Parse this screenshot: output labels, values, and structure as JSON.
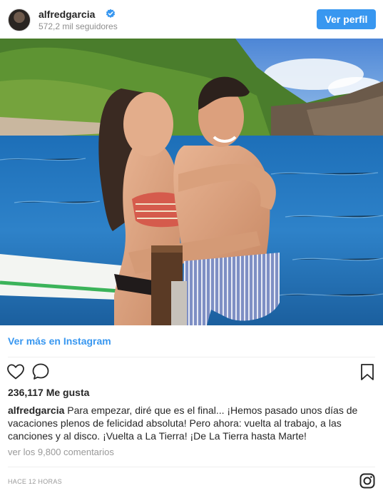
{
  "header": {
    "username": "alfredgarcia",
    "followers": "572,2 mil seguidores",
    "profile_button": "Ver perfil",
    "verified_icon": "verified-badge-icon",
    "verified_color": "#3897f0"
  },
  "post": {
    "view_more": "Ver más en Instagram",
    "likes": "236,117 Me gusta",
    "caption_user": "alfredgarcia",
    "caption_text": "Para empezar, diré que es el final... ¡Hemos pasado unos días de vacaciones plenos de felicidad absoluta! Pero ahora: vuelta al trabajo, a las canciones y al disco. ¡Vuelta a La Tierra! ¡De La Tierra hasta Marte!",
    "comments": "ver los 9,800 comentarios",
    "time": "HACE 12 HORAS"
  },
  "icons": {
    "like": "heart-icon",
    "comment": "comment-icon",
    "save": "bookmark-icon",
    "instagram": "instagram-logo-icon"
  },
  "colors": {
    "accent": "#3897f0",
    "text": "#262626",
    "muted": "#999999"
  }
}
